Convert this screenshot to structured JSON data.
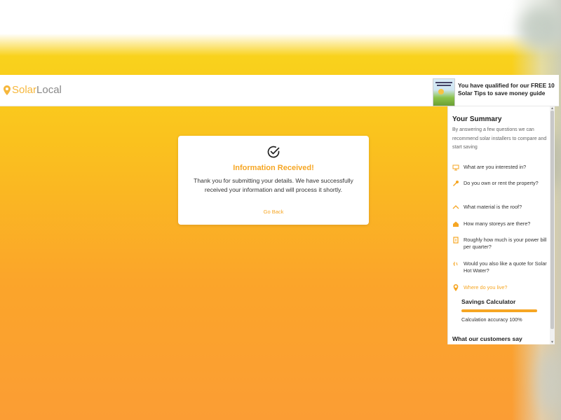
{
  "header": {
    "logo_solar": "Solar",
    "logo_local": "Local",
    "guide_text": "You have qualified for our FREE 10 Solar Tips to save money guide"
  },
  "card": {
    "title": "Information Received!",
    "body": "Thank you for submitting your details. We have successfully received your information and will process it shortly.",
    "go_back": "Go Back"
  },
  "summary": {
    "title": "Your Summary",
    "description": "By answering a few questions we can recommend solar installers to compare and start saving",
    "questions": [
      {
        "label": "What are you interested in?",
        "icon": "solar-panel-icon"
      },
      {
        "label": "Do you own or rent the property?",
        "icon": "key-icon"
      },
      {
        "label": "What material is the roof?",
        "icon": "roof-icon"
      },
      {
        "label": "How many storeys are there?",
        "icon": "house-icon"
      },
      {
        "label": "Roughly how much is your power bill per quarter?",
        "icon": "bill-icon"
      },
      {
        "label": "Would you also like a quote for Solar Hot Water?",
        "icon": "hot-water-icon"
      },
      {
        "label": "Where do you live?",
        "icon": "location-pin-icon"
      }
    ],
    "calculator_title": "Savings Calculator",
    "calculator_accuracy_value": 1.0,
    "calculator_accuracy_text": "Calculation accuracy 100%",
    "customers_title": "What our customers say"
  },
  "colors": {
    "accent": "#f6a623",
    "logo_solar": "#f6b73c",
    "bg_top": "#f9d21c",
    "bg_bottom": "#fb9d34"
  }
}
